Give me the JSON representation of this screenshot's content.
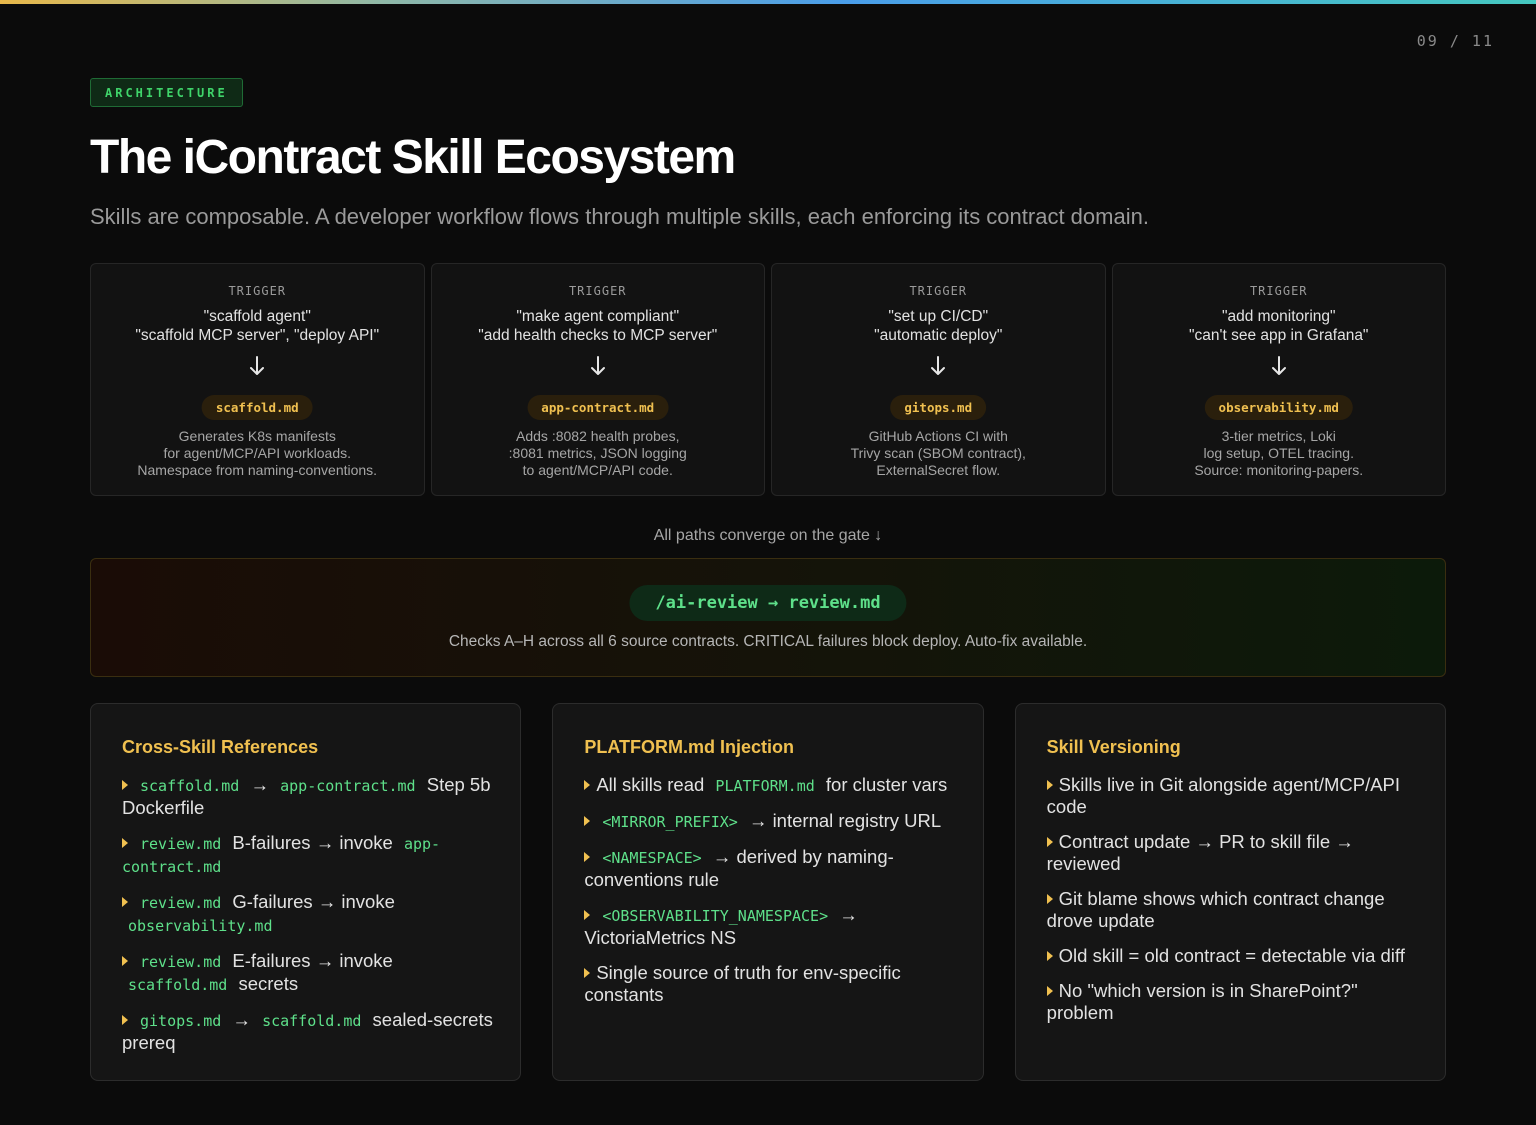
{
  "page_counter": "09 / 11",
  "badge": "ARCHITECTURE",
  "title": "The iContract Skill Ecosystem",
  "subtitle": "Skills are composable. A developer workflow flows through multiple skills, each enforcing its contract domain.",
  "flows": [
    {
      "trigger_label": "TRIGGER",
      "trigger_lines": [
        "\"scaffold agent\"",
        "\"scaffold MCP server\", \"deploy API\""
      ],
      "skill": "scaffold.md",
      "desc_lines": [
        "Generates K8s manifests",
        "for agent/MCP/API workloads.",
        "Namespace from naming-conventions."
      ]
    },
    {
      "trigger_label": "TRIGGER",
      "trigger_lines": [
        "\"make agent compliant\"",
        "\"add health checks to MCP server\""
      ],
      "skill": "app-contract.md",
      "desc_lines": [
        "Adds :8082 health probes,",
        ":8081 metrics, JSON logging",
        "to agent/MCP/API code."
      ]
    },
    {
      "trigger_label": "TRIGGER",
      "trigger_lines": [
        "\"set up CI/CD\"",
        "\"automatic deploy\""
      ],
      "skill": "gitops.md",
      "desc_lines": [
        "GitHub Actions CI with",
        "Trivy scan (SBOM contract),",
        "ExternalSecret flow."
      ]
    },
    {
      "trigger_label": "TRIGGER",
      "trigger_lines": [
        "\"add monitoring\"",
        "\"can't see app in Grafana\""
      ],
      "skill": "observability.md",
      "desc_lines": [
        "3-tier metrics, Loki",
        "log setup, OTEL tracing.",
        "Source: monitoring-papers."
      ]
    }
  ],
  "converge_text": "All paths converge on the gate ↓",
  "gate": {
    "command": "/ai-review → review.md",
    "desc": "Checks A–H across all 6 source contracts. CRITICAL failures block deploy. Auto-fix available."
  },
  "panels": [
    {
      "title": "Cross-Skill References",
      "items": [
        [
          {
            "c": "scaffold.md"
          },
          {
            "t": " → "
          },
          {
            "c": "app-contract.md"
          },
          {
            "t": " Step 5b Dockerfile"
          }
        ],
        [
          {
            "c": "review.md"
          },
          {
            "t": " B-failures → invoke "
          },
          {
            "c": "app-contract.md"
          }
        ],
        [
          {
            "c": "review.md"
          },
          {
            "t": " G-failures → invoke "
          },
          {
            "c": "observability.md"
          }
        ],
        [
          {
            "c": "review.md"
          },
          {
            "t": " E-failures → invoke "
          },
          {
            "c": "scaffold.md"
          },
          {
            "t": " secrets"
          }
        ],
        [
          {
            "c": "gitops.md"
          },
          {
            "t": " → "
          },
          {
            "c": "scaffold.md"
          },
          {
            "t": " sealed-secrets prereq"
          }
        ]
      ]
    },
    {
      "title": "PLATFORM.md Injection",
      "items": [
        [
          {
            "t": "All skills read "
          },
          {
            "c": "PLATFORM.md"
          },
          {
            "t": " for cluster vars"
          }
        ],
        [
          {
            "c": "<MIRROR_PREFIX>"
          },
          {
            "t": " → internal registry URL"
          }
        ],
        [
          {
            "c": "<NAMESPACE>"
          },
          {
            "t": " → derived by naming-conventions rule"
          }
        ],
        [
          {
            "c": "<OBSERVABILITY_NAMESPACE>"
          },
          {
            "t": " → VictoriaMetrics NS"
          }
        ],
        [
          {
            "t": "Single source of truth for env-specific constants"
          }
        ]
      ]
    },
    {
      "title": "Skill Versioning",
      "items": [
        [
          {
            "t": "Skills live in Git alongside agent/MCP/API code"
          }
        ],
        [
          {
            "t": "Contract update → PR to skill file → reviewed"
          }
        ],
        [
          {
            "t": "Git blame shows which contract change drove update"
          }
        ],
        [
          {
            "t": "Old skill = old contract = detectable via diff"
          }
        ],
        [
          {
            "t": "No \"which version is in SharePoint?\" problem"
          }
        ]
      ]
    }
  ],
  "colors": {
    "accent_gold": "#f0c050",
    "accent_green": "#5ee08a",
    "badge_green": "#3fd46a",
    "background": "#0b0b0b"
  },
  "icons": {
    "flow_arrow": "arrow-down-icon",
    "bullet": "caret-right-icon"
  }
}
